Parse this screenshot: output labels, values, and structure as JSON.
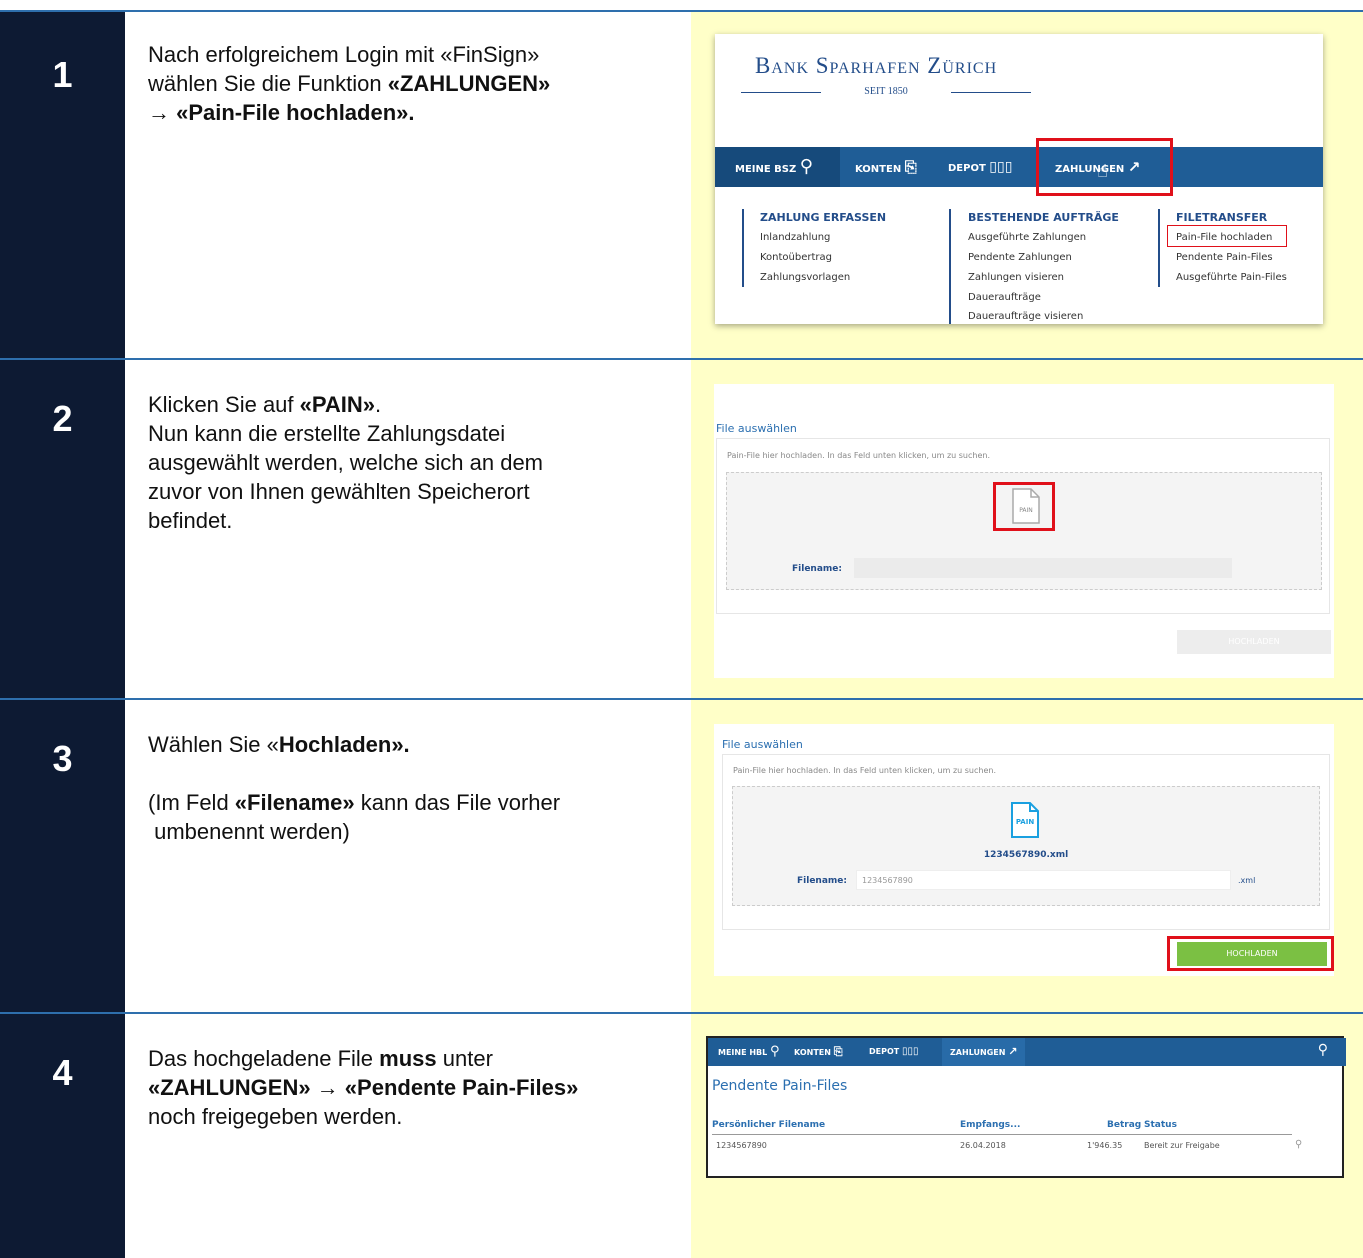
{
  "steps": [
    {
      "number": "1",
      "line1": "Nach erfolgreichem Login mit «FinSign»",
      "line2a": "wählen Sie die Funktion ",
      "line2b": "«ZAHLUNGEN»",
      "line3": "→ «Pain-File hochladen»."
    },
    {
      "number": "2",
      "line1a": "Klicken Sie auf ",
      "line1b": "«PAIN»",
      "line1c": ".",
      "line2": "Nun kann die erstellte Zahlungsdatei",
      "line3": "ausgewählt werden, welche sich an dem",
      "line4": "zuvor von Ihnen gewählten Speicherort",
      "line5": "befindet."
    },
    {
      "number": "3",
      "line1a": "Wählen Sie «",
      "line1b": "Hochladen».",
      "line2a": "(Im Feld ",
      "line2b": "«Filename»",
      "line2c": " kann das File vorher",
      "line3": " umbenennt werden)"
    },
    {
      "number": "4",
      "line1a": "Das hochgeladene File ",
      "line1b": "muss",
      "line1c": " unter",
      "line2": "«ZAHLUNGEN» → «Pendente Pain-Files»",
      "line3": "noch freigegeben werden."
    }
  ],
  "shot1": {
    "bank_name": "Bank Sparhafen Zürich",
    "seit": "SEIT 1850",
    "nav": [
      "MEINE BSZ",
      "KONTEN",
      "DEPOT",
      "ZAHLUNGEN"
    ],
    "col1": {
      "title": "ZAHLUNG ERFASSEN",
      "items": [
        "Inlandzahlung",
        "Kontoübertrag",
        "Zahlungsvorlagen"
      ]
    },
    "col2": {
      "title": "BESTEHENDE AUFTRÄGE",
      "items": [
        "Ausgeführte Zahlungen",
        "Pendente Zahlungen",
        "Zahlungen visieren",
        "Daueraufträge",
        "Daueraufträge visieren"
      ]
    },
    "col3": {
      "title": "FILETRANSFER",
      "items": [
        "Pain-File hochladen",
        "Pendente Pain-Files",
        "Ausgeführte Pain-Files"
      ]
    }
  },
  "shot2": {
    "title": "File auswählen",
    "hint": "Pain-File hier hochladen. In das Feld unten klicken, um zu suchen.",
    "icon_label": "PAIN",
    "filename_label": "Filename:",
    "button": "HOCHLADEN"
  },
  "shot3": {
    "title": "File auswählen",
    "hint": "Pain-File hier hochladen. In das Feld unten klicken, um zu suchen.",
    "icon_label": "PAIN",
    "file": "1234567890.xml",
    "filename_label": "Filename:",
    "filename_value": "1234567890",
    "ext": ".xml",
    "button": "HOCHLADEN"
  },
  "shot4": {
    "nav": [
      "MEINE HBL",
      "KONTEN",
      "DEPOT",
      "ZAHLUNGEN"
    ],
    "title": "Pendente Pain-Files",
    "headers": [
      "Persönlicher Filename",
      "Empfangs...",
      "Betrag",
      "Status"
    ],
    "row": [
      "1234567890",
      "26.04.2018",
      "1'946.35",
      "Bereit zur Freigabe"
    ]
  },
  "colors": {
    "navy": "#0d1a33",
    "yellow": "#ffffc8",
    "accent": "#e0101a",
    "blue": "#1f5d96",
    "green": "#7bc043"
  }
}
